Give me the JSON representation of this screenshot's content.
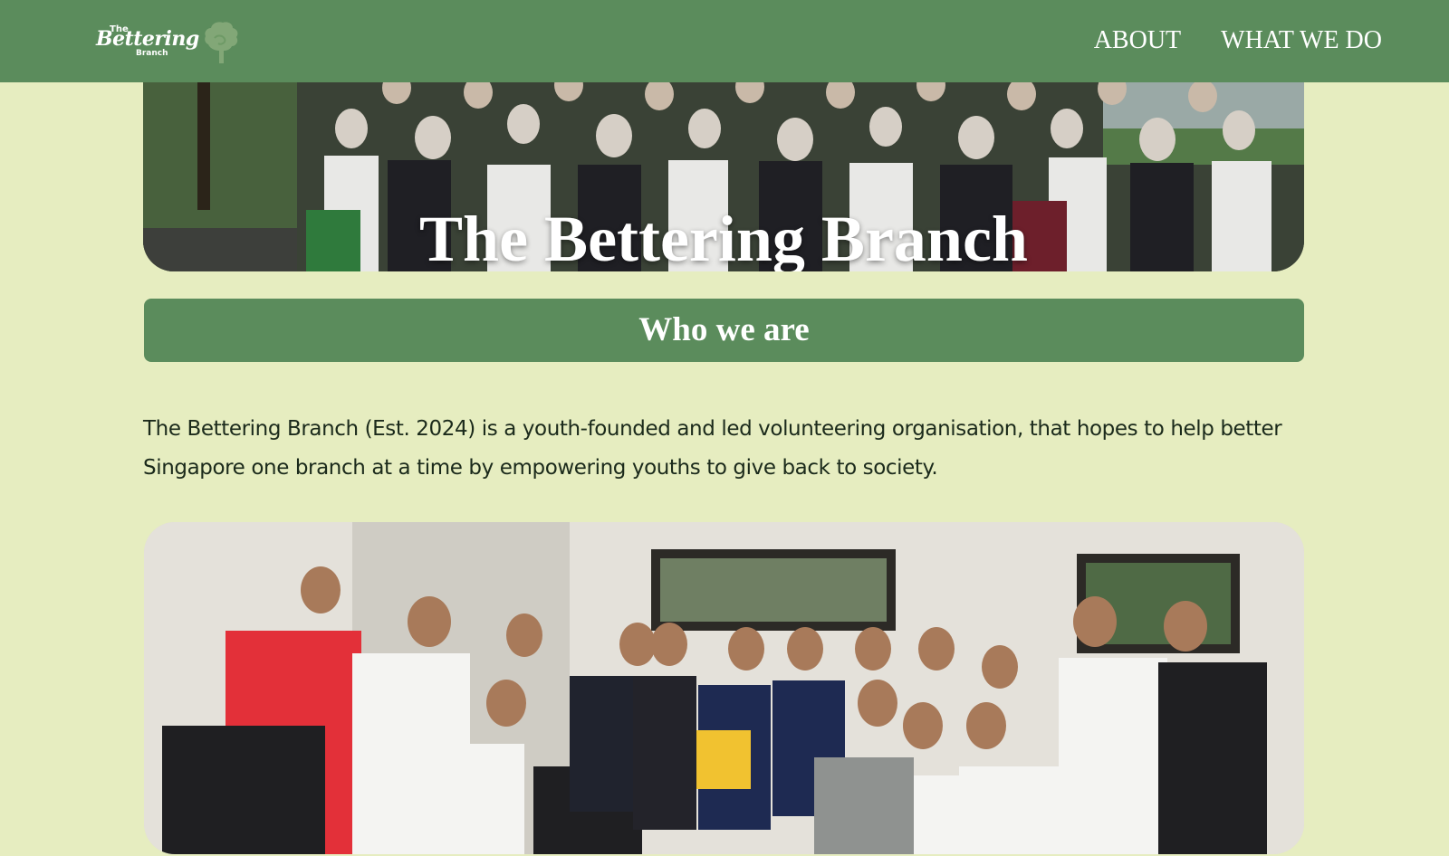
{
  "nav": {
    "logo": {
      "the": "The",
      "bettering": "Bettering",
      "branch": "Branch"
    },
    "links": [
      {
        "label": "ABOUT"
      },
      {
        "label": "WHAT WE DO"
      }
    ]
  },
  "hero": {
    "title": "The Bettering Branch"
  },
  "who": {
    "title": "Who we are",
    "body": "The Bettering Branch (Est. 2024) is a youth-founded and led volunteering organisation, that hopes to help better Singapore one branch at a time by empowering youths to give back to society."
  },
  "colors": {
    "nav_green": "#5b8c5c",
    "page_background": "#e6edc0",
    "text_dark": "#1b2a1b"
  },
  "icons": {
    "tree": "tree-icon"
  }
}
